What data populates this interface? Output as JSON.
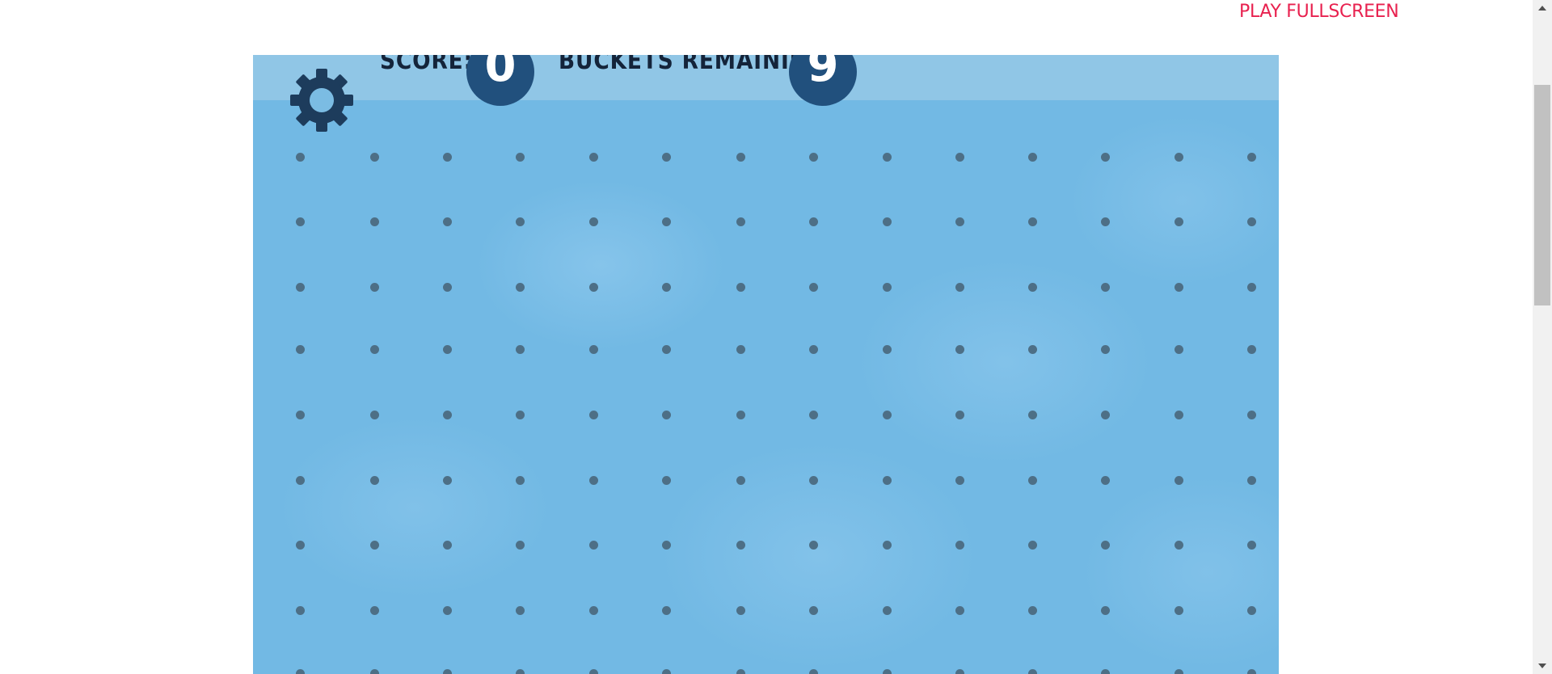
{
  "header": {
    "fullscreen_label": "PLAY FULLSCREEN",
    "accent_color": "#e8214f"
  },
  "game": {
    "score_label": "SCORE:",
    "score_value": "0",
    "buckets_label": "BUCKETS REMAINING:",
    "buckets_value": "9",
    "settings_icon": "gear-icon",
    "background_color": "#72b9e4",
    "hud_circle_color": "#21507d",
    "peg_color": "#4d6f86"
  }
}
